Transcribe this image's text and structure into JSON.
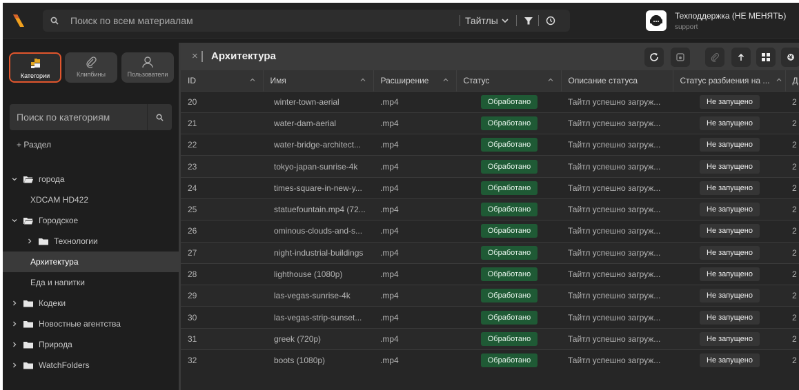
{
  "search": {
    "placeholder": "Поиск по всем материалам",
    "scope": "Тайтлы"
  },
  "user": {
    "name": "Техподдержка (НЕ МЕНЯТЬ)",
    "login": "support"
  },
  "colors": {
    "accent": "#e2562d",
    "status_ok": "#1f5a35",
    "logo_orange": "#f0a01e"
  },
  "sidebar": {
    "modes": [
      {
        "label": "Категории",
        "icon": "categories-icon",
        "active": true
      },
      {
        "label": "Клипбины",
        "icon": "paperclip-icon",
        "active": false
      },
      {
        "label": "Пользователи",
        "icon": "user-icon",
        "active": false
      }
    ],
    "search_placeholder": "Поиск по категориям",
    "add_section": "+ Раздел",
    "tree": [
      {
        "label": "города",
        "level": 0,
        "expanded": true,
        "folder": true
      },
      {
        "label": "XDCAM HD422",
        "level": 1,
        "expanded": null,
        "folder": false
      },
      {
        "label": "Городское",
        "level": 0,
        "expanded": true,
        "folder": true
      },
      {
        "label": "Технологии",
        "level": 1,
        "expanded": false,
        "folder": true
      },
      {
        "label": "Архитектура",
        "level": 1,
        "expanded": null,
        "folder": false,
        "selected": true
      },
      {
        "label": "Еда и напитки",
        "level": 1,
        "expanded": null,
        "folder": false
      },
      {
        "label": "Кодеки",
        "level": 0,
        "expanded": false,
        "folder": true
      },
      {
        "label": "Новостные агентства",
        "level": 0,
        "expanded": false,
        "folder": true
      },
      {
        "label": "Природа",
        "level": 0,
        "expanded": false,
        "folder": true
      },
      {
        "label": "WatchFolders",
        "level": 0,
        "expanded": false,
        "folder": true
      }
    ]
  },
  "main": {
    "close": "×",
    "title": "Архитектура",
    "toolbar": [
      "refresh-icon",
      "save-icon",
      "paperclip-icon",
      "arrow-up-icon",
      "grid-icon",
      "gear-icon"
    ],
    "columns": [
      "ID",
      "Имя",
      "Расширение",
      "Статус",
      "Описание статуса",
      "Статус разбиения на ...",
      "Д"
    ],
    "rows": [
      {
        "id": "20",
        "name": "winter-town-aerial",
        "ext": ".mp4",
        "status": "Обработано",
        "desc": "Тайтл успешно загруж...",
        "split": "Не запущено",
        "d": "2"
      },
      {
        "id": "21",
        "name": "water-dam-aerial",
        "ext": ".mp4",
        "status": "Обработано",
        "desc": "Тайтл успешно загруж...",
        "split": "Не запущено",
        "d": "2"
      },
      {
        "id": "22",
        "name": "water-bridge-architect...",
        "ext": ".mp4",
        "status": "Обработано",
        "desc": "Тайтл успешно загруж...",
        "split": "Не запущено",
        "d": "2"
      },
      {
        "id": "23",
        "name": "tokyo-japan-sunrise-4k",
        "ext": ".mp4",
        "status": "Обработано",
        "desc": "Тайтл успешно загруж...",
        "split": "Не запущено",
        "d": "2"
      },
      {
        "id": "24",
        "name": "times-square-in-new-y...",
        "ext": ".mp4",
        "status": "Обработано",
        "desc": "Тайтл успешно загруж...",
        "split": "Не запущено",
        "d": "2"
      },
      {
        "id": "25",
        "name": "statuefountain.mp4 (72...",
        "ext": ".mp4",
        "status": "Обработано",
        "desc": "Тайтл успешно загруж...",
        "split": "Не запущено",
        "d": "2"
      },
      {
        "id": "26",
        "name": "ominous-clouds-and-s...",
        "ext": ".mp4",
        "status": "Обработано",
        "desc": "Тайтл успешно загруж...",
        "split": "Не запущено",
        "d": "2"
      },
      {
        "id": "27",
        "name": "night-industrial-buildings",
        "ext": ".mp4",
        "status": "Обработано",
        "desc": "Тайтл успешно загруж...",
        "split": "Не запущено",
        "d": "2"
      },
      {
        "id": "28",
        "name": "lighthouse (1080p)",
        "ext": ".mp4",
        "status": "Обработано",
        "desc": "Тайтл успешно загруж...",
        "split": "Не запущено",
        "d": "2"
      },
      {
        "id": "29",
        "name": "las-vegas-sunrise-4k",
        "ext": ".mp4",
        "status": "Обработано",
        "desc": "Тайтл успешно загруж...",
        "split": "Не запущено",
        "d": "2"
      },
      {
        "id": "30",
        "name": "las-vegas-strip-sunset...",
        "ext": ".mp4",
        "status": "Обработано",
        "desc": "Тайтл успешно загруж...",
        "split": "Не запущено",
        "d": "2"
      },
      {
        "id": "31",
        "name": "greek (720p)",
        "ext": ".mp4",
        "status": "Обработано",
        "desc": "Тайтл успешно загруж...",
        "split": "Не запущено",
        "d": "2"
      },
      {
        "id": "32",
        "name": "boots (1080p)",
        "ext": ".mp4",
        "status": "Обработано",
        "desc": "Тайтл успешно загруж...",
        "split": "Не запущено",
        "d": "2"
      }
    ]
  }
}
